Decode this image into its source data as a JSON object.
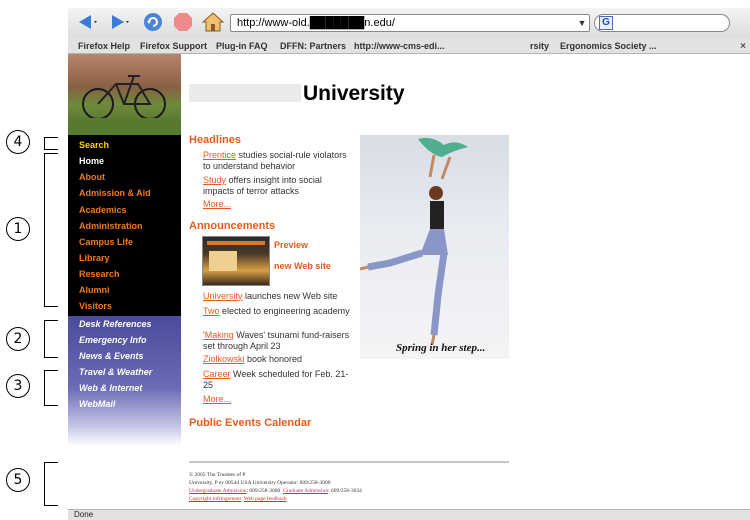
{
  "browser": {
    "url": "http://www-old.███████n.edu/",
    "url_dropdown_glyph": "▼",
    "search_engine_glyph": "G",
    "bookmarks": [
      "Firefox Help",
      "Firefox Support",
      "Plug-in FAQ",
      "DFFN: Partners",
      "http://www-cms-edi...",
      "rsity",
      "Ergonomics Society ..."
    ],
    "bookmarks_close": "×",
    "status": "Done"
  },
  "site": {
    "title_suffix": "University",
    "search_label": "Search",
    "main_nav": [
      "Home",
      "About",
      "Admission & Aid",
      "Academics",
      "Administration",
      "Campus Life",
      "Library",
      "Research",
      "Alumni",
      "Visitors"
    ],
    "utility_nav_group1": [
      "Desk References",
      "Emergency Info",
      "News & Events"
    ],
    "utility_nav_group2": [
      "Travel & Weather",
      "Web & Internet",
      "WebMail"
    ],
    "headlines": {
      "heading": "Headlines",
      "items": [
        {
          "link": "Prentice",
          "text": " studies social-rule violators to understand behavior"
        },
        {
          "link": "Study",
          "text": " offers insight into social impacts of terror attacks"
        }
      ],
      "more": "More..."
    },
    "announcements": {
      "heading": "Announcements",
      "preview_line1": "Preview",
      "preview_line2": "new Web site",
      "items": [
        {
          "link": "University",
          "text": " launches new Web site"
        },
        {
          "link": "Two",
          "text": " elected to engineering academy"
        },
        {
          "link": "'Making",
          "text": " Waves' tsunami fund-raisers set through April 23"
        },
        {
          "link": "Ziolkowski",
          "text": " book honored"
        },
        {
          "link": "Career",
          "text": " Week scheduled for Feb. 21-25"
        }
      ],
      "more": "More..."
    },
    "events_heading": "Public Events Calendar",
    "photo_caption": "Spring in her step...",
    "footer": {
      "copyright": "© 2005 The Trustees of P",
      "address": "University, P                    ey 08544 USA   University Operator: 609/258-3000",
      "undergrad_link": "Undergraduate Admission",
      "undergrad_phone": ": 609/258-3060",
      "grad_link": "Graduate Admission",
      "grad_phone": ": 609/258-3034",
      "copyright_link": "Copyright infringement",
      "feedback_link": "Web page feedback"
    }
  },
  "annotations": [
    "4",
    "1",
    "2",
    "3",
    "5"
  ],
  "colors": {
    "accent_orange": "#e85a1c",
    "nav_black": "#000000",
    "nav_purple": "#4b4b9c"
  },
  "icons": [
    "back-icon",
    "forward-icon",
    "reload-icon",
    "stop-icon",
    "home-icon",
    "search-engine-icon"
  ]
}
